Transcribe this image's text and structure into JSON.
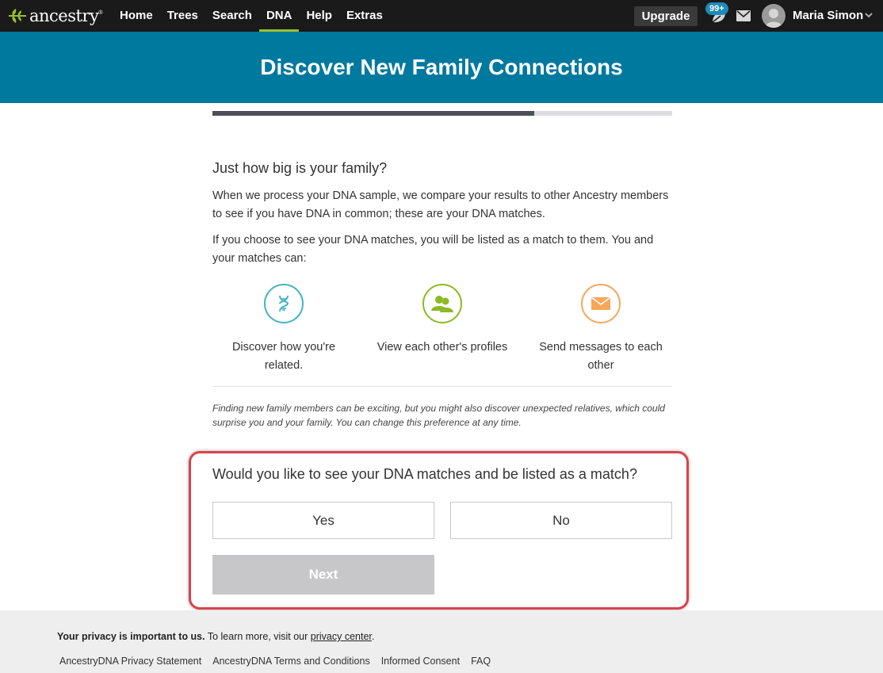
{
  "nav": {
    "logo": "ancestry",
    "logo_tm": "®",
    "items": [
      {
        "label": "Home"
      },
      {
        "label": "Trees"
      },
      {
        "label": "Search"
      },
      {
        "label": "DNA",
        "active": true
      },
      {
        "label": "Help"
      },
      {
        "label": "Extras"
      }
    ],
    "upgrade": "Upgrade",
    "hints_badge": "99+",
    "username": "Maria Simon"
  },
  "banner": {
    "title": "Discover New Family Connections"
  },
  "progress": {
    "fraction": 0.7
  },
  "intro": {
    "heading": "Just how big is your family?",
    "para1": "When we process your DNA sample, we compare your results to other Ancestry members to see if you have DNA in common; these are your DNA matches.",
    "para2": "If you choose to see your DNA matches, you will be listed as a match to them. You and your matches can:"
  },
  "features": [
    {
      "text": "Discover how you're related.",
      "icon": "dna-icon",
      "color": "#44b3c2"
    },
    {
      "text": "View each other's profiles",
      "icon": "people-icon",
      "color": "#8cb924"
    },
    {
      "text": "Send messages to each other",
      "icon": "envelope-icon",
      "color": "#f5a85a"
    }
  ],
  "disclaimer": "Finding new family members can be exciting, but you might also discover unexpected relatives, which could surprise you and your family. You can change this preference at any time.",
  "question": {
    "text": "Would you like to see your DNA matches and be listed as a match?",
    "yes": "Yes",
    "no": "No",
    "next": "Next"
  },
  "footer": {
    "privacy_bold": "Your privacy is important to us.",
    "privacy_text": " To learn more, visit our ",
    "privacy_link": "privacy center",
    "privacy_end": ".",
    "links": [
      "AncestryDNA Privacy Statement",
      "AncestryDNA Terms and Conditions",
      "Informed Consent",
      "FAQ"
    ]
  },
  "colors": {
    "nav_bg": "#1a1a1a",
    "banner": "#00799f",
    "active_nav": "#9cbe30",
    "highlight": "#d9434a"
  }
}
